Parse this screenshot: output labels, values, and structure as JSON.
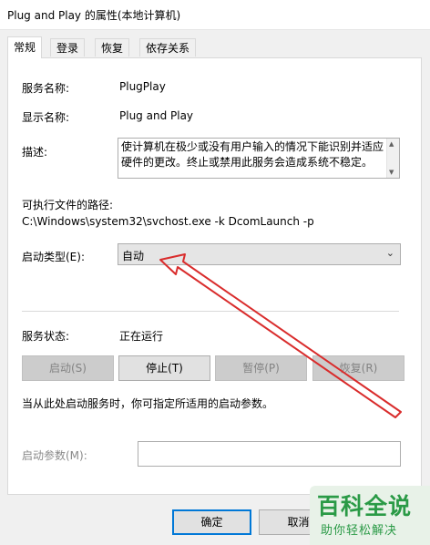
{
  "window": {
    "title": "Plug and Play 的属性(本地计算机)"
  },
  "tabs": [
    {
      "label": "常规"
    },
    {
      "label": "登录"
    },
    {
      "label": "恢复"
    },
    {
      "label": "依存关系"
    }
  ],
  "general": {
    "service_name_label": "服务名称:",
    "service_name_value": "PlugPlay",
    "display_name_label": "显示名称:",
    "display_name_value": "Plug and Play",
    "description_label": "描述:",
    "description_value": "使计算机在极少或没有用户输入的情况下能识别并适应硬件的更改。终止或禁用此服务会造成系统不稳定。",
    "exe_path_label": "可执行文件的路径:",
    "exe_path_value": "C:\\Windows\\system32\\svchost.exe -k DcomLaunch -p",
    "startup_type_label": "启动类型(E):",
    "startup_type_value": "自动",
    "service_status_label": "服务状态:",
    "service_status_value": "正在运行",
    "buttons": {
      "start": "启动(S)",
      "stop": "停止(T)",
      "pause": "暂停(P)",
      "resume": "恢复(R)"
    },
    "hint": "当从此处启动服务时，你可指定所适用的启动参数。",
    "start_params_label": "启动参数(M):",
    "start_params_value": ""
  },
  "footer": {
    "ok": "确定",
    "cancel": "取消"
  },
  "watermark": {
    "title": "百科全说",
    "subtitle": "助你轻松解决"
  },
  "colors": {
    "annotation_arrow": "#d92c2c",
    "watermark_green": "#2a9a46"
  }
}
